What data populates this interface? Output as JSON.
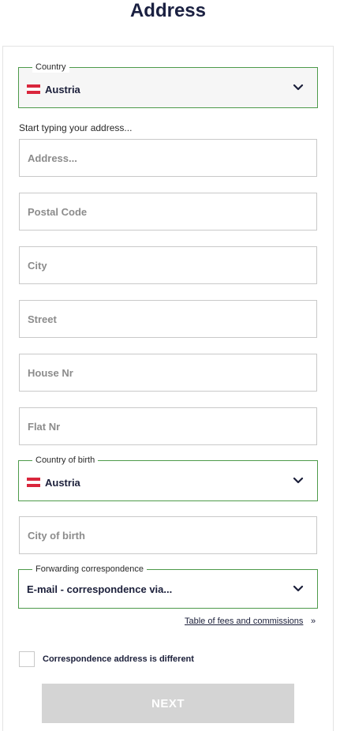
{
  "page": {
    "title": "Address"
  },
  "country": {
    "legend": "Country",
    "value": "Austria"
  },
  "address_hint": "Start typing your address...",
  "fields": {
    "address": {
      "placeholder": "Address..."
    },
    "postal_code": {
      "placeholder": "Postal Code"
    },
    "city": {
      "placeholder": "City"
    },
    "street": {
      "placeholder": "Street"
    },
    "house_nr": {
      "placeholder": "House Nr"
    },
    "flat_nr": {
      "placeholder": "Flat Nr"
    },
    "city_of_birth": {
      "placeholder": "City of birth"
    }
  },
  "country_of_birth": {
    "legend": "Country of birth",
    "value": "Austria"
  },
  "forwarding": {
    "legend": "Forwarding correspondence",
    "value": "E-mail - correspondence via..."
  },
  "fees_link": {
    "label": "Table of fees and commissions",
    "arrow": "»"
  },
  "correspondence_checkbox": {
    "label": "Correspondence address is different",
    "checked": false
  },
  "next_button": {
    "label": "NEXT"
  },
  "colors": {
    "accent_border": "#4d9a4a",
    "disabled_button": "#d4d4d4",
    "title": "#1a2041",
    "flag_red": "#d9263c"
  }
}
